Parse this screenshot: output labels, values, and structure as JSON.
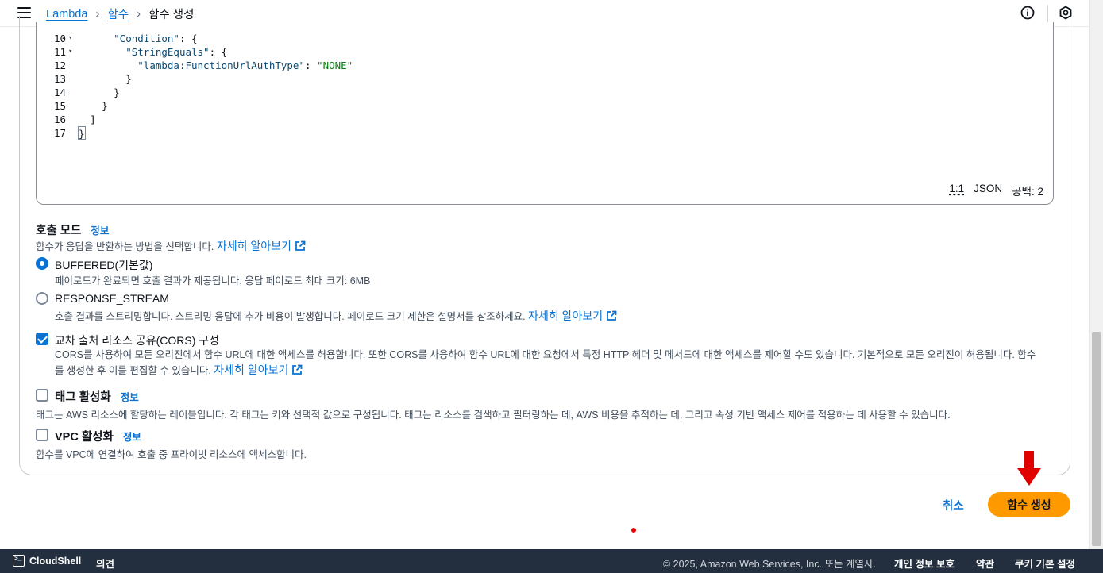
{
  "nav": {
    "breadcrumbs": [
      "Lambda",
      "함수",
      "함수 생성"
    ]
  },
  "editor": {
    "lines": [
      {
        "n": "10",
        "fold": "▾",
        "parts": [
          [
            "sp",
            "      "
          ],
          [
            "key",
            "\"Condition\""
          ],
          [
            "punct",
            ": {"
          ]
        ]
      },
      {
        "n": "11",
        "fold": "▾",
        "parts": [
          [
            "sp",
            "        "
          ],
          [
            "key",
            "\"StringEquals\""
          ],
          [
            "punct",
            ": {"
          ]
        ]
      },
      {
        "n": "12",
        "fold": "",
        "parts": [
          [
            "sp",
            "          "
          ],
          [
            "key",
            "\"lambda:FunctionUrlAuthType\""
          ],
          [
            "punct",
            ": "
          ],
          [
            "str",
            "\"NONE\""
          ]
        ]
      },
      {
        "n": "13",
        "fold": "",
        "parts": [
          [
            "sp",
            "        "
          ],
          [
            "punct",
            "}"
          ]
        ]
      },
      {
        "n": "14",
        "fold": "",
        "parts": [
          [
            "sp",
            "      "
          ],
          [
            "punct",
            "}"
          ]
        ]
      },
      {
        "n": "15",
        "fold": "",
        "parts": [
          [
            "sp",
            "    "
          ],
          [
            "punct",
            "}"
          ]
        ]
      },
      {
        "n": "16",
        "fold": "",
        "parts": [
          [
            "sp",
            "  "
          ],
          [
            "punct",
            "]"
          ]
        ]
      },
      {
        "n": "17",
        "fold": "",
        "parts": [
          [
            "cursor",
            "}"
          ]
        ]
      }
    ],
    "status": {
      "position": "1:1",
      "language": "JSON",
      "spacing": "공백: 2"
    }
  },
  "invoke_mode": {
    "title": "호출 모드",
    "info": "정보",
    "desc": "함수가 응답을 반환하는 방법을 선택합니다.",
    "learn_more": "자세히 알아보기",
    "options": [
      {
        "label": "BUFFERED(기본값)",
        "desc": "페이로드가 완료되면 호출 결과가 제공됩니다. 응답 페이로드 최대 크기: 6MB",
        "selected": true
      },
      {
        "label": "RESPONSE_STREAM",
        "desc": "호출 결과를 스트리밍합니다. 스트리밍 응답에 추가 비용이 발생합니다. 페이로드 크기 제한은 설명서를 참조하세요.",
        "learn_more": "자세히 알아보기",
        "selected": false
      }
    ]
  },
  "cors": {
    "label": "교차 출처 리소스 공유(CORS) 구성",
    "checked": true,
    "desc_line1": "CORS를 사용하여 모든 오리진에서 함수 URL에 대한 액세스를 허용합니다. 또한 CORS를 사용하여 함수 URL에 대한 요청에서 특정 HTTP 헤더 및 메서드에 대한 액세스를 제어할 수도 있습니다. 기본적으로 모든 오리진이 허용됩니다. 함수",
    "desc_line2": "를 생성한 후 이를 편집할 수 있습니다.",
    "learn_more": "자세히 알아보기"
  },
  "tags": {
    "label": "태그 활성화",
    "info": "정보",
    "checked": false,
    "desc": "태그는 AWS 리소스에 할당하는 레이블입니다. 각 태그는 키와 선택적 값으로 구성됩니다. 태그는 리소스를 검색하고 필터링하는 데, AWS 비용을 추적하는 데, 그리고 속성 기반 액세스 제어를 적용하는 데 사용할 수 있습니다."
  },
  "vpc": {
    "label": "VPC 활성화",
    "info": "정보",
    "checked": false,
    "desc": "함수를 VPC에 연결하여 호출 중 프라이빗 리소스에 액세스합니다."
  },
  "actions": {
    "cancel": "취소",
    "create": "함수 생성"
  },
  "footer": {
    "cloudshell": "CloudShell",
    "feedback": "의견",
    "copyright": "© 2025, Amazon Web Services, Inc. 또는 계열사.",
    "privacy": "개인 정보 보호",
    "terms": "약관",
    "cookies": "쿠키 기본 설정"
  },
  "colors": {
    "accent": "#0972d3",
    "primary_button": "#ff9900",
    "footer_bg": "#232f3e",
    "annotation": "#e00000"
  }
}
